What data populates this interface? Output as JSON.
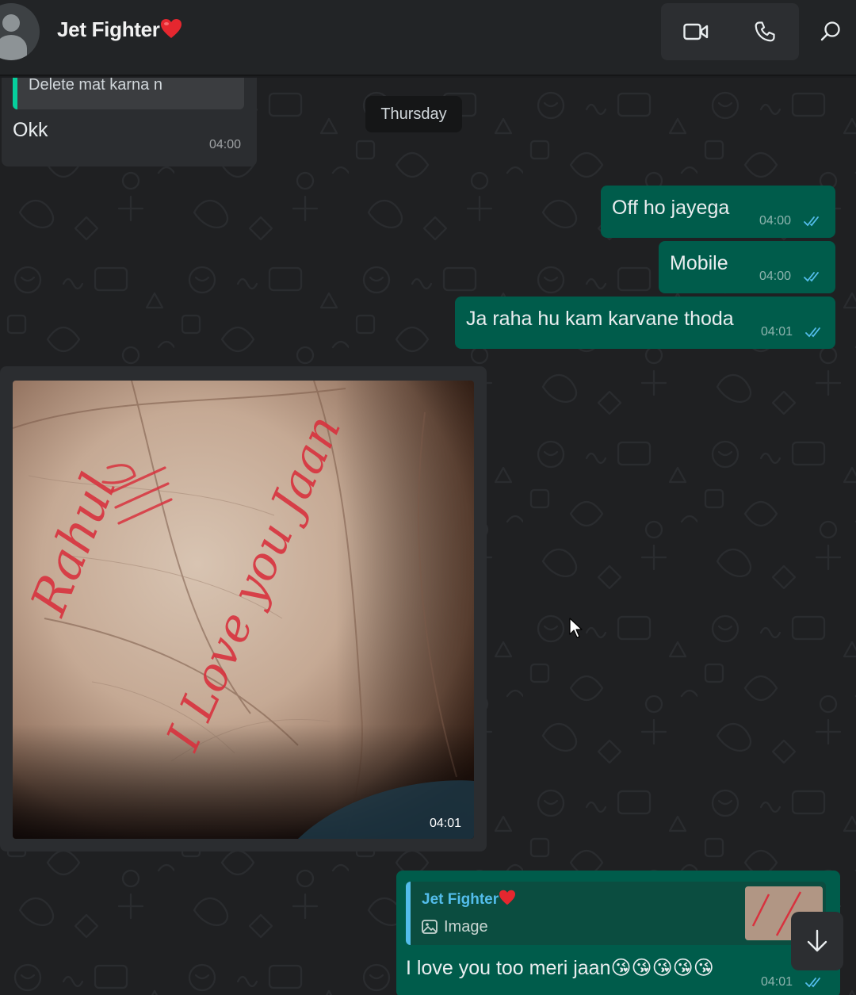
{
  "header": {
    "contact_name": "Jet Fighter",
    "heart_emoji": "❤️",
    "icons": [
      "avatar-icon",
      "video-call-icon",
      "voice-call-icon",
      "search-icon"
    ]
  },
  "date_separator": "Thursday",
  "messages": [
    {
      "direction": "incoming",
      "quoted_text": "Delete mat karna n",
      "text": "Okk",
      "time": "04:00"
    },
    {
      "direction": "outgoing",
      "text": "Off ho jayega",
      "time": "04:00",
      "status": "read"
    },
    {
      "direction": "outgoing",
      "text": "Mobile",
      "time": "04:00",
      "status": "read"
    },
    {
      "direction": "outgoing",
      "text": "Ja raha hu kam karvane thoda",
      "time": "04:01",
      "status": "read"
    },
    {
      "direction": "incoming",
      "type": "image",
      "photo_description": "palm with red handwriting",
      "photo_text": [
        "Rahul",
        "I Love you Jaan"
      ],
      "time": "04:01"
    },
    {
      "direction": "outgoing",
      "quoted_author": "Jet Fighter",
      "quoted_heart": "❤️",
      "quoted_kind": "Image",
      "text": "I love you too meri jaan",
      "emojis": "😘😘😘😘😘",
      "time": "04:01",
      "status": "read"
    }
  ],
  "colors": {
    "outgoing_bubble": "#005c4b",
    "incoming_bubble": "#2b2d30",
    "read_ticks": "#53bdeb",
    "quote_accent": "#06cf9c"
  }
}
